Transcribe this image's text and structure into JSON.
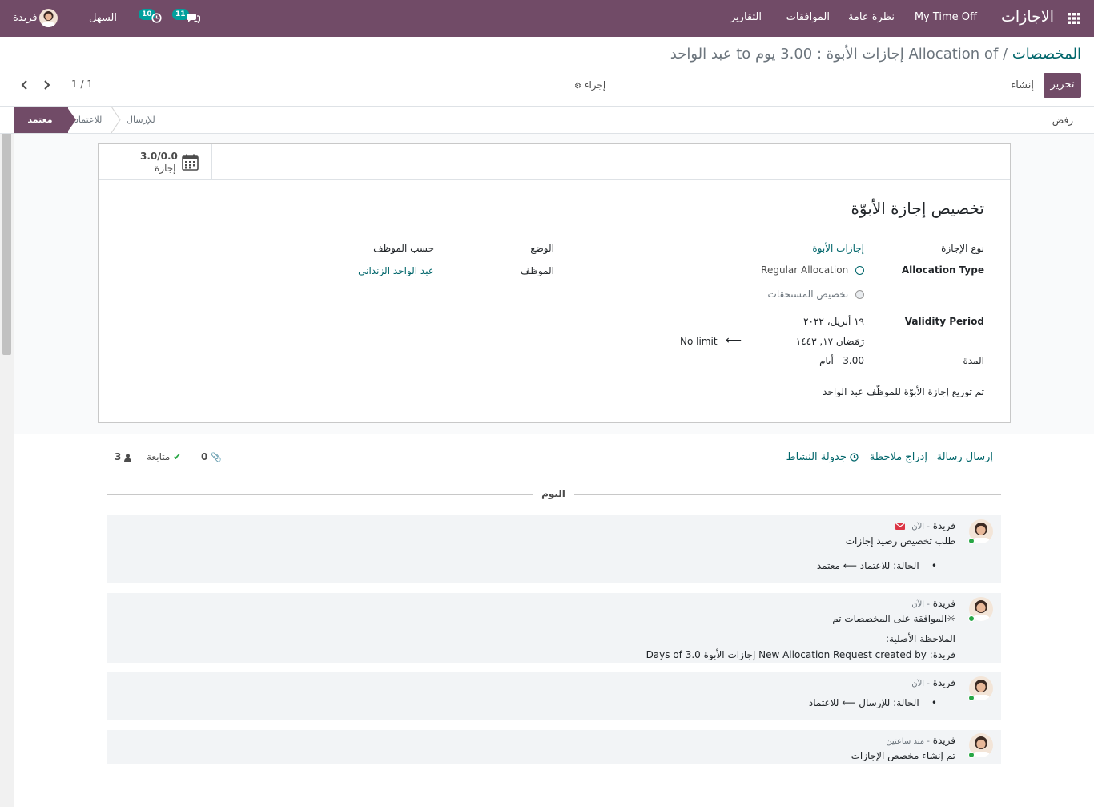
{
  "navbar": {
    "app_title": "الاجازات",
    "menu": [
      "My Time Off",
      "نظرة عامة",
      "الموافقات",
      "التقارير"
    ],
    "messages_count": "11",
    "activities_count": "10",
    "company": "السهل",
    "user": "فريدة"
  },
  "control_panel": {
    "breadcrumb_parent": "المخصصات",
    "breadcrumb_separator": "/",
    "breadcrumb_current": "Allocation of إجازات الأبوة : 3.00 يوم to عبد الواحد",
    "edit_label": "تحرير",
    "create_label": "إنشاء",
    "action_label": "إجراء",
    "pager": "1 / 1"
  },
  "statusbar": {
    "refuse_label": "رفض",
    "stages": [
      "معتمد",
      "للاعتماد",
      "للإرسال"
    ],
    "active_stage": "معتمد"
  },
  "smart_button": {
    "value": "3.0/0.0",
    "label": "إجازة"
  },
  "form": {
    "title": "تخصيص إجازة الأبوّة",
    "leave_type_label": "نوع الإجازة",
    "leave_type_value": "إجازات الأبوة",
    "allocation_type_label": "Allocation Type",
    "allocation_options": [
      "Regular Allocation",
      "تخصيص المستحقات"
    ],
    "validity_label": "Validity Period",
    "date_from": "١٩ أبريل، ٢٠٢٢",
    "date_from_hijri": "رَمَضان ١٧, ١٤٤٣",
    "date_to": "No limit",
    "duration_label": "المدة",
    "duration_value": "3.00",
    "duration_unit": "أيام",
    "mode_label": "الوضع",
    "mode_value": "حسب الموظف",
    "employee_label": "الموظف",
    "employee_value": "عبد الواحد الزنداني",
    "note": "تم توزيع إجازة الأبوّة للموظّف عبد الواحد"
  },
  "chatter": {
    "send_message": "إرسال رسالة",
    "log_note": "إدراج ملاحظة",
    "schedule_activity": "جدولة النشاط",
    "attachments_count": "0",
    "follow_label": "متابعة",
    "followers_count": "3",
    "today_label": "اليوم",
    "messages": [
      {
        "author": "فريدة",
        "time": "- الآن",
        "text": "طلب تخصيص رصيد إجازات",
        "tracking": "الحالة: للاعتماد ⟵ معتمد"
      },
      {
        "author": "فريدة",
        "time": "- الآن",
        "text": "الموافقة على المخصصات تم",
        "note_label": "الملاحظة الأصلية:",
        "note_text": "فريدة: New Allocation Request created by إجازات الأبوة 3.0 Days of"
      },
      {
        "author": "فريدة",
        "time": "- الآن",
        "tracking": "الحالة: للإرسال ⟵ للاعتماد"
      },
      {
        "author": "فريدة",
        "time": "- منذ ساعتين",
        "text": "تم إنشاء مخصص الإجازات"
      }
    ]
  },
  "colors": {
    "brand": "#714b67",
    "link": "#01666b",
    "badge": "#00a09d"
  }
}
